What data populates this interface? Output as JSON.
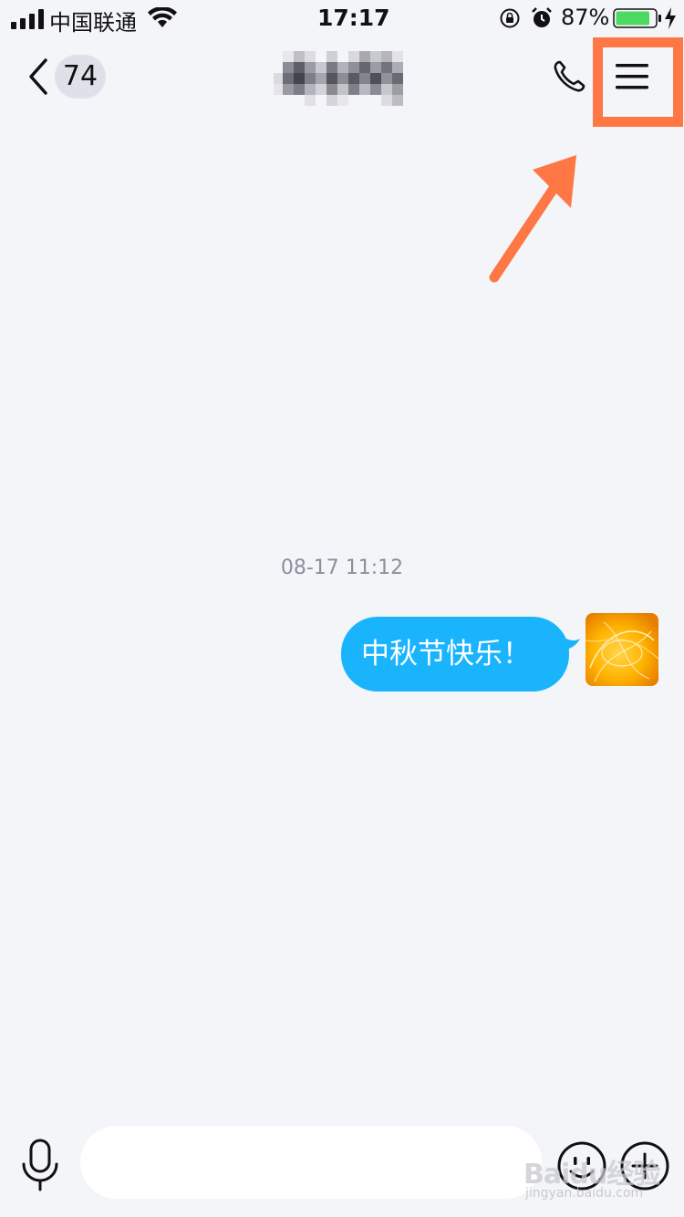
{
  "status_bar": {
    "carrier": "中国联通",
    "time": "17:17",
    "battery_percent": "87%",
    "battery_level": 0.87,
    "icons": [
      "signal-icon",
      "wifi-icon",
      "orientation-lock-icon",
      "alarm-icon",
      "battery-icon",
      "charging-icon"
    ]
  },
  "nav": {
    "back_icon": "chevron-left-icon",
    "unread_count": "74",
    "title": "",
    "call_icon": "phone-icon",
    "menu_icon": "hamburger-menu-icon"
  },
  "annotation": {
    "highlight_color": "#ff7744",
    "arrow_color": "#ff7744"
  },
  "conversation": {
    "timestamp": "08-17 11:12",
    "messages": [
      {
        "text": "中秋节快乐！",
        "sender": "self",
        "bubble_color": "#1ab4fd"
      }
    ]
  },
  "input_bar": {
    "mic_icon": "microphone-icon",
    "placeholder": "",
    "emoji_icon": "emoji-icon",
    "plus_icon": "plus-icon"
  },
  "watermark": {
    "text": "Baidu经验",
    "sub": "jingyan.baidu.com"
  }
}
